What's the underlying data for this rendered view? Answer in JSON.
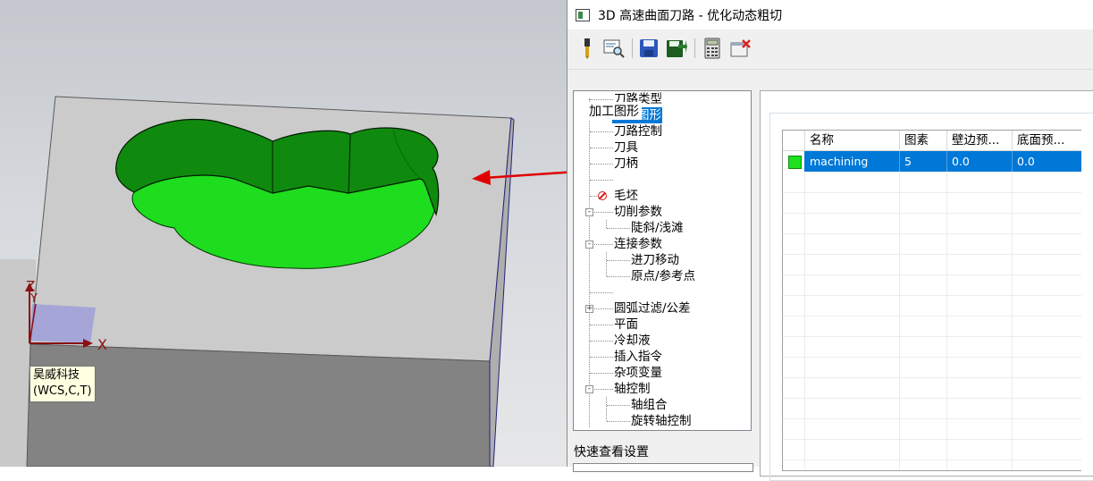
{
  "viewport": {
    "wcs_label": "昊威科技\n(WCS,C,T)",
    "axes": {
      "z": "Z",
      "y": "Y",
      "x": "X"
    }
  },
  "dialog": {
    "title": "3D 高速曲面刀路 - 优化动态粗切",
    "toolbar": [
      "tool-icon",
      "preview-icon",
      "save-icon",
      "export-icon",
      "calculator-icon",
      "close-window-icon"
    ],
    "tree": [
      {
        "label": "刀路类型"
      },
      {
        "label": "模型图形",
        "selected": true,
        "status": "check"
      },
      {
        "label": "刀路控制"
      },
      {
        "label": "刀具"
      },
      {
        "label": "刀柄"
      },
      {
        "label": ""
      },
      {
        "label": "毛坯",
        "status": "forbidden"
      },
      {
        "label": "切削参数",
        "expand": "-"
      },
      {
        "label": "陡斜/浅滩",
        "child": true
      },
      {
        "label": "连接参数",
        "expand": "-"
      },
      {
        "label": "进刀移动",
        "child": true
      },
      {
        "label": "原点/参考点",
        "child": true
      },
      {
        "label": ""
      },
      {
        "label": "圆弧过滤/公差",
        "expand": "+"
      },
      {
        "label": "平面"
      },
      {
        "label": "冷却液"
      },
      {
        "label": "插入指令"
      },
      {
        "label": "杂项变量"
      },
      {
        "label": "轴控制",
        "expand": "-"
      },
      {
        "label": "轴组合",
        "child": true
      },
      {
        "label": "旋转轴控制",
        "child": true
      }
    ],
    "quick_view": "快速查看设置",
    "group_title": "加工图形",
    "grid": {
      "columns": [
        "名称",
        "图素",
        "壁边预...",
        "底面预..."
      ],
      "rows": [
        {
          "color": "#1ee01e",
          "cells": [
            "machining",
            "5",
            "0.0",
            "0.0"
          ]
        }
      ]
    }
  },
  "colors": {
    "selection": "#0078d7",
    "model_green": "#1ee01e",
    "arrow": "#e00000"
  }
}
